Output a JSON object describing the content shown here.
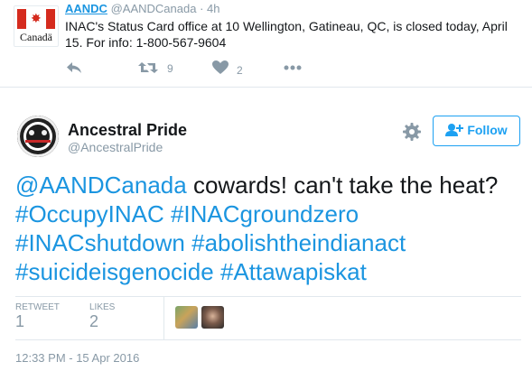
{
  "colors": {
    "accent": "#1da1f2",
    "link": "#1b95e0",
    "muted": "#8899a6",
    "flag_red": "#d52b1e"
  },
  "parent_tweet": {
    "author_name": "AANDC",
    "author_handle": "@AANDCanada",
    "time_sep": "·",
    "time": "4h",
    "text": "INAC's Status Card office at 10 Wellington, Gatineau, QC, is closed today, April 15. For info: 1-800-567-9604",
    "logo_text": "Canadä",
    "actions": {
      "retweet_count": "9",
      "like_count": "2",
      "icons": [
        "reply-icon",
        "retweet-icon",
        "heart-icon",
        "more-icon"
      ]
    }
  },
  "main_tweet": {
    "author_name": "Ancestral Pride",
    "author_handle": "@AncestralPride",
    "follow_label": "Follow",
    "text": {
      "mention": "@AANDCanada",
      "body": " cowards! can't take the heat? ",
      "hashtags": [
        "#OccupyINAC",
        "#INACgroundzero",
        "#INACshutdown",
        "#abolishtheindianact",
        "#suicideisgenocide",
        "#Attawapiskat"
      ]
    },
    "stats": {
      "retweet_label": "RETWEET",
      "retweet_count": "1",
      "likes_label": "LIKES",
      "likes_count": "2"
    },
    "timestamp": "12:33 PM - 15 Apr 2016"
  }
}
